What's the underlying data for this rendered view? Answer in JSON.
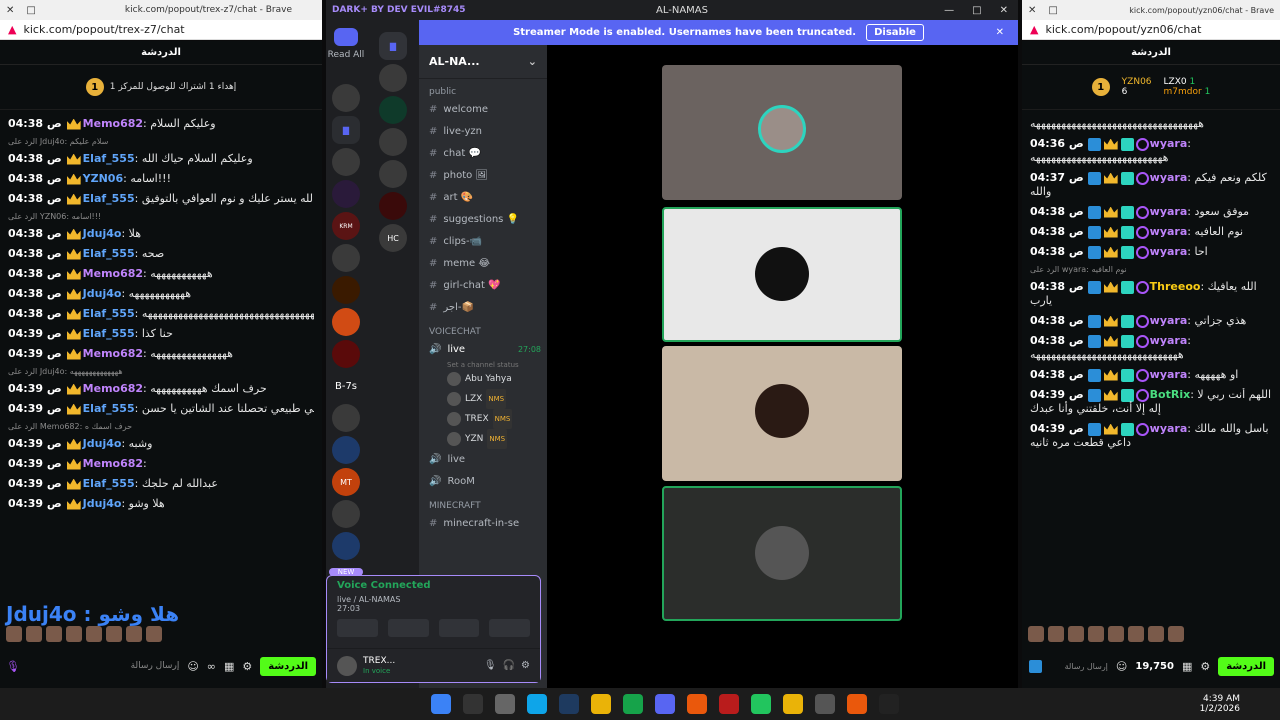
{
  "left_browser": {
    "tab_title": "kick.com/popout/trex-z7/chat - Brave",
    "url": "kick.com/popout/trex-z7/chat",
    "header": "الدردشة",
    "pinned": {
      "rank": "1",
      "text": "إهداء 1 اشتراك للوصول للمركز 1"
    },
    "messages": [
      {
        "time": "04:38 ص",
        "user": "Memo682",
        "color": "#c084fc",
        "text": "وعليكم السلام"
      },
      {
        "reply": "الرد على Jduj4o: سلام عليكم"
      },
      {
        "time": "04:38 ص",
        "user": "Elaf_555",
        "color": "#60a5fa",
        "text": "وعليكم السلام حياك الله"
      },
      {
        "time": "04:38 ص",
        "user": "YZN06",
        "color": "#60a5fa",
        "text": "اسامه!!!"
      },
      {
        "time": "04:38 ص",
        "user": "Elaf_555",
        "color": "#60a5fa",
        "text": "الله يستر عليك و نوم العوافي بالتوفيق"
      },
      {
        "reply": "الرد على YZN06: اسامه!!!"
      },
      {
        "time": "04:38 ص",
        "user": "Jduj4o",
        "color": "#60a5fa",
        "text": "هلا"
      },
      {
        "time": "04:38 ص",
        "user": "Elaf_555",
        "color": "#60a5fa",
        "text": "صحه"
      },
      {
        "time": "04:38 ص",
        "user": "Memo682",
        "color": "#c084fc",
        "text": "هههههههههههه"
      },
      {
        "time": "04:38 ص",
        "user": "Jduj4o",
        "color": "#60a5fa",
        "text": "هههههههههههه"
      },
      {
        "time": "04:38 ص",
        "user": "Elaf_555",
        "color": "#60a5fa",
        "text": "هههههههههههههههههههههههههههههههههههه"
      },
      {
        "time": "04:39 ص",
        "user": "Elaf_555",
        "color": "#60a5fa",
        "text": "حنا كذا"
      },
      {
        "time": "04:39 ص",
        "user": "Memo682",
        "color": "#c084fc",
        "text": "هههههههههههههههه"
      },
      {
        "reply": "الرد على Jduj4o: هههههههههههههه"
      },
      {
        "time": "04:39 ص",
        "user": "Memo682",
        "color": "#c084fc",
        "text": "حرف اسمك ههههههههههه"
      },
      {
        "time": "04:39 ص",
        "user": "Elaf_555",
        "color": "#60a5fa",
        "text": "شي طبيعي تحصلنا عند الشاتين يا حسن"
      },
      {
        "reply": "الرد على Memo682: حرف اسمك ه"
      },
      {
        "time": "04:39 ص",
        "user": "Jduj4o",
        "color": "#60a5fa",
        "text": "وشبه"
      },
      {
        "time": "04:39 ص",
        "user": "Memo682",
        "color": "#c084fc",
        "text": ""
      },
      {
        "time": "04:39 ص",
        "user": "Elaf_555",
        "color": "#60a5fa",
        "text": "عبدالله لم حلجك"
      },
      {
        "time": "04:39 ص",
        "user": "Jduj4o",
        "color": "#60a5fa",
        "text": "هلا وشو"
      }
    ],
    "overlay_text": "Jduj4o : هلا وشو",
    "input_placeholder": "إرسال رسالة",
    "chat_button": "الدردشة"
  },
  "discord": {
    "title": "AL-NAMAS",
    "dark_plus": "DARK+ BY DEV EVIL#8745",
    "banner_text": "Streamer Mode is enabled. Usernames have been truncated.",
    "banner_button": "Disable",
    "read_all": "Read All",
    "server_name": "AL-NA...",
    "categories": [
      "public",
      "VOICECHAT",
      "MINECRAFT"
    ],
    "channels": [
      "welcome",
      "live-yzn",
      "chat 💬",
      "photo 🖼",
      "art 🎨",
      "suggestions 💡",
      "clips-📹",
      "meme 😂",
      "girl-chat 💖",
      "اجر-📦"
    ],
    "voice": {
      "name": "live",
      "time": "27:08",
      "status": "Set a channel status"
    },
    "voice_users": [
      "Abu Yahya",
      "LZX",
      "TREX",
      "YZN"
    ],
    "nms": "NMS",
    "other_voice": [
      "live",
      "RooM"
    ],
    "mc_channel": "minecraft-in-se",
    "connected": {
      "title": "Voice Connected",
      "sub": "live / AL-NAMAS",
      "time": "27:03"
    },
    "user": {
      "name": "TREX...",
      "status": "In voice"
    },
    "new_badge": "NEW",
    "servers_label": "B-7s"
  },
  "right_browser": {
    "tab_title": "kick.com/popout/yzn06/chat - Brave",
    "url": "kick.com/popout/yzn06/chat",
    "header": "الدردشة",
    "top": [
      {
        "name": "YZN06",
        "count": "6"
      },
      {
        "name": "LZX0",
        "count": "1"
      },
      {
        "name": "m7mdor",
        "count": "1"
      }
    ],
    "messages": [
      {
        "time": "",
        "user": "",
        "text": "هههههههههههههههههههههههههههههههههه"
      },
      {
        "time": "04:36 ص",
        "user": "wyara",
        "text": "ههههههههههههههههههههههههههه"
      },
      {
        "time": "04:37 ص",
        "user": "wyara",
        "text": "كلكم ونعم فيكم والله"
      },
      {
        "time": "04:38 ص",
        "user": "wyara",
        "text": "موفق سعود"
      },
      {
        "time": "04:38 ص",
        "user": "wyara",
        "text": "نوم العافيه"
      },
      {
        "time": "04:38 ص",
        "user": "wyara",
        "text": "احا"
      },
      {
        "reply": "الرد على wyara: نوم العافيه"
      },
      {
        "time": "04:38 ص",
        "user": "Threeoo",
        "text": "الله يعافيك يارب"
      },
      {
        "time": "04:38 ص",
        "user": "wyara",
        "text": "هذي جزاتي"
      },
      {
        "time": "04:38 ص",
        "user": "wyara",
        "text": "هههههههههههههههههههههههههههههه"
      },
      {
        "time": "04:38 ص",
        "user": "wyara",
        "text": "او هههههه"
      },
      {
        "time": "04:39 ص",
        "user": "BotRix",
        "text": "اللهم أنت ربي لا إله إلا أنت، خلقتني وأنا عبدك"
      },
      {
        "time": "04:39 ص",
        "user": "wyara",
        "text": "باسل والله مالك داعي قطعت مره ثانيه"
      }
    ],
    "input_placeholder": "إرسال رسالة",
    "points": "19,750",
    "chat_button": "الدردشة"
  },
  "taskbar": {
    "time": "4:39 AM",
    "date": "1/2/2026"
  }
}
